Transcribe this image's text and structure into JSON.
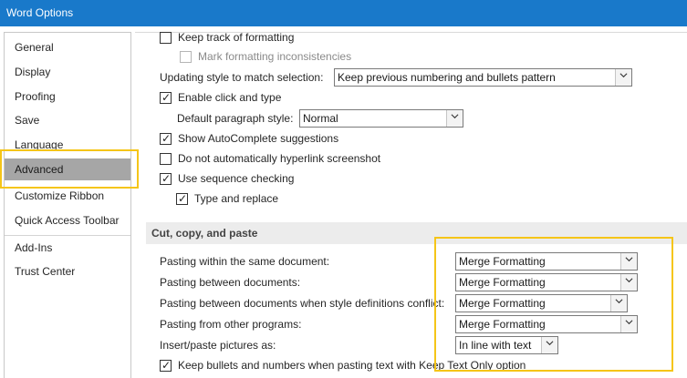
{
  "window": {
    "title": "Word Options"
  },
  "sidebar": {
    "items": [
      {
        "label": "General"
      },
      {
        "label": "Display"
      },
      {
        "label": "Proofing"
      },
      {
        "label": "Save"
      },
      {
        "label": "Language"
      },
      {
        "label": "Advanced",
        "selected": true
      },
      {
        "label": "Customize Ribbon"
      },
      {
        "label": "Quick Access Toolbar"
      },
      {
        "label": "Add-Ins"
      },
      {
        "label": "Trust Center"
      }
    ]
  },
  "editing": {
    "keep_track_formatting": {
      "label": "Keep track of formatting",
      "checked": false
    },
    "mark_formatting_inconsistencies": {
      "label": "Mark formatting inconsistencies",
      "checked": false,
      "disabled": true
    },
    "updating_style": {
      "label": "Updating style to match selection:",
      "value": "Keep previous numbering and bullets pattern"
    },
    "enable_click_and_type": {
      "label": "Enable click and type",
      "checked": true
    },
    "default_paragraph_style": {
      "label": "Default paragraph style:",
      "value": "Normal"
    },
    "show_autocomplete": {
      "label": "Show AutoComplete suggestions",
      "checked": true
    },
    "no_hyperlink_screenshot": {
      "label": "Do not automatically hyperlink screenshot",
      "checked": false
    },
    "use_sequence_checking": {
      "label": "Use sequence checking",
      "checked": true
    },
    "type_and_replace": {
      "label": "Type and replace",
      "checked": true
    }
  },
  "cut_copy_paste": {
    "header": "Cut, copy, and paste",
    "same_document": {
      "label": "Pasting within the same document:",
      "value": "Merge Formatting"
    },
    "between_documents": {
      "label": "Pasting between documents:",
      "value": "Merge Formatting"
    },
    "style_conflict": {
      "label": "Pasting between documents when style definitions conflict:",
      "value": "Merge Formatting"
    },
    "other_programs": {
      "label": "Pasting from other programs:",
      "value": "Merge Formatting"
    },
    "insert_pictures": {
      "label": "Insert/paste pictures as:",
      "value": "In line with text"
    },
    "keep_bullets": {
      "label": "Keep bullets and numbers when pasting text with Keep Text Only option",
      "checked": true
    }
  },
  "colors": {
    "titlebar": "#1979ca",
    "highlight": "#f5c518",
    "selected_nav": "#a6a6a6"
  }
}
